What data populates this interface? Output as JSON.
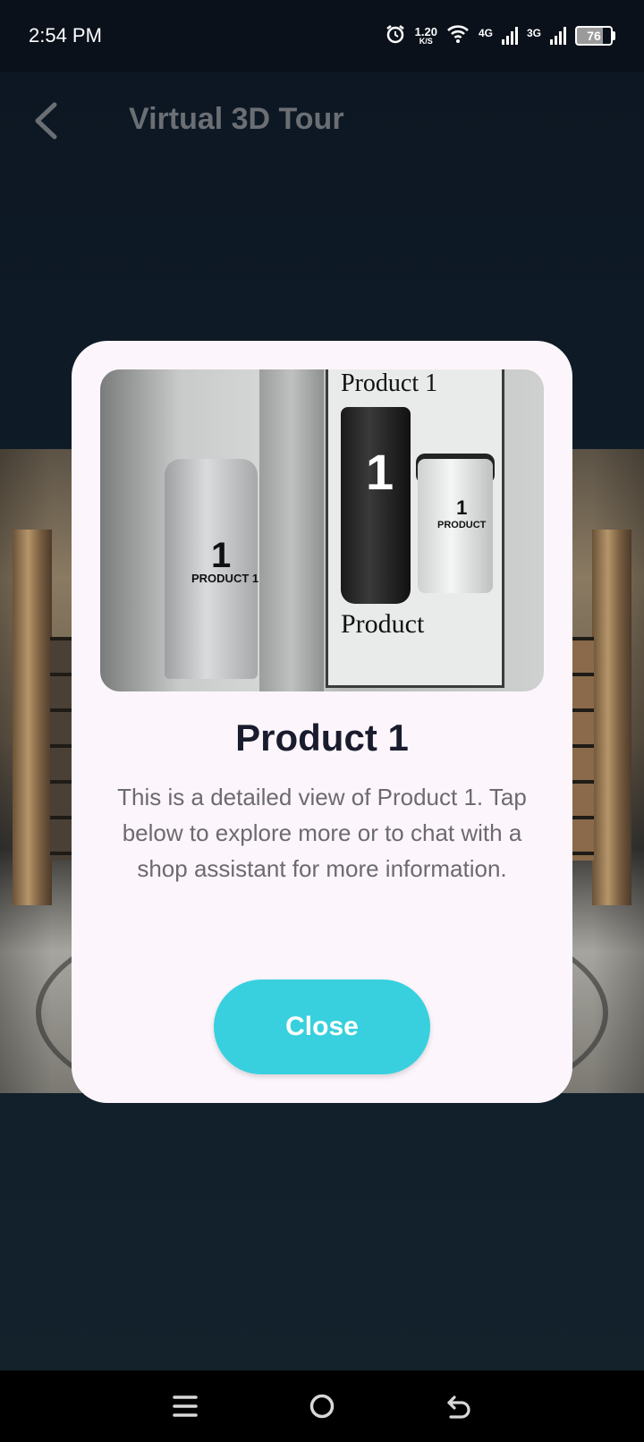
{
  "status_bar": {
    "time": "2:54 PM",
    "net_speed_value": "1.20",
    "net_speed_unit": "K/S",
    "sim1_label": "4G",
    "sim2_label": "3G",
    "battery": "76"
  },
  "app_bar": {
    "title": "Virtual 3D Tour"
  },
  "dialog": {
    "image_texts": {
      "box_title": "Product 1",
      "box_bottom": "Product",
      "tube_number": "1",
      "jar_number": "1",
      "jar_label": "PRODUCT",
      "bottle_number": "1",
      "bottle_label": "PRODUCT 1"
    },
    "title": "Product 1",
    "description": "This is a detailed view of Product 1. Tap below to explore more or to chat with a shop assistant for more information.",
    "close_label": "Close"
  },
  "colors": {
    "accent": "#38d0de",
    "dialog_bg": "#fcf6fc",
    "title_text": "#1a1c2e",
    "body_text": "#6c6a70"
  }
}
